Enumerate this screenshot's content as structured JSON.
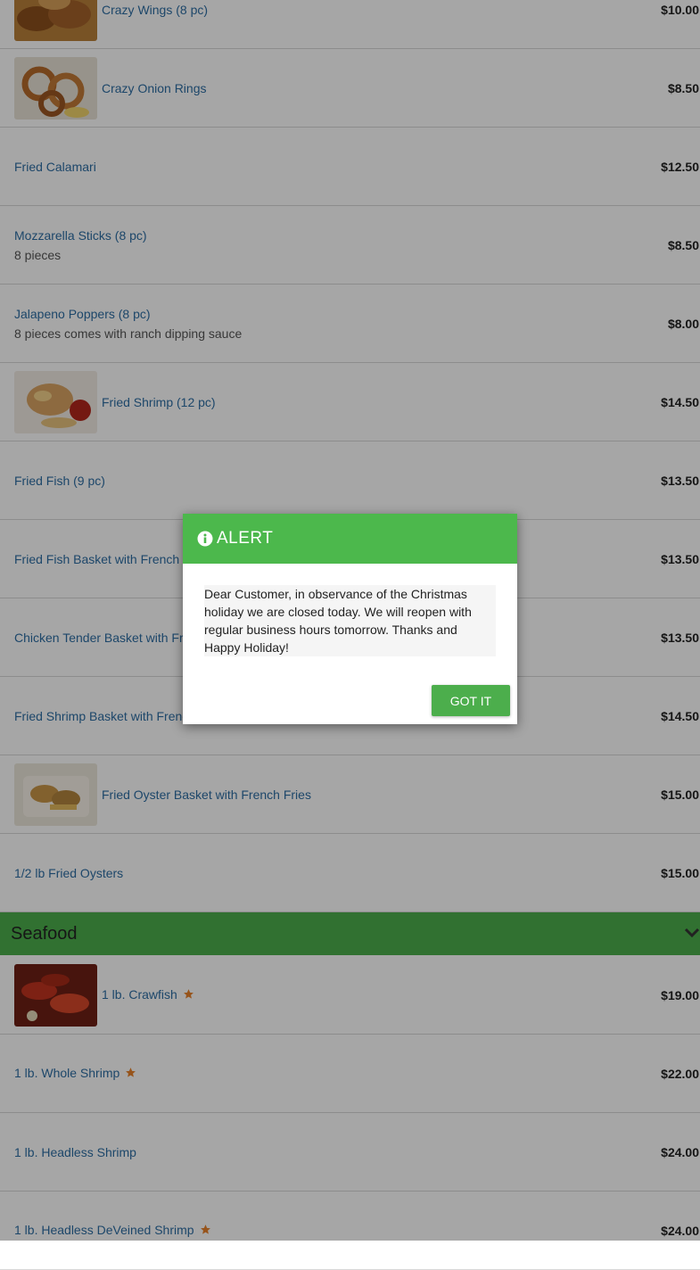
{
  "items_top": [
    {
      "name": "Crazy Wings (8 pc)",
      "desc": "",
      "price": "$10.00",
      "image": "wings-photo"
    },
    {
      "name": "Crazy Onion Rings",
      "desc": "",
      "price": "$8.50",
      "image": "onion-rings-photo"
    },
    {
      "name": "Fried Calamari",
      "desc": "",
      "price": "$12.50"
    },
    {
      "name": "Mozzarella Sticks (8 pc)",
      "desc": "8 pieces",
      "price": "$8.50"
    },
    {
      "name": "Jalapeno Poppers (8 pc)",
      "desc": "8 pieces comes with ranch dipping sauce",
      "price": "$8.00"
    },
    {
      "name": "Fried Shrimp (12 pc)",
      "desc": "",
      "price": "$14.50",
      "image": "fried-shrimp-photo"
    },
    {
      "name": "Fried Fish (9 pc)",
      "desc": "",
      "price": "$13.50"
    },
    {
      "name": "Fried Fish Basket with French Fries",
      "desc": "",
      "price": "$13.50"
    },
    {
      "name": "Chicken Tender Basket with French Fries",
      "desc": "",
      "price": "$13.50"
    },
    {
      "name": "Fried Shrimp Basket with French Fries",
      "desc": "",
      "price": "$14.50"
    },
    {
      "name": "Fried Oyster Basket with French Fries",
      "desc": "",
      "price": "$15.00",
      "image": "oyster-basket-photo"
    },
    {
      "name": "1/2 lb Fried Oysters",
      "desc": "",
      "price": "$15.00"
    }
  ],
  "section": {
    "title": "Seafood",
    "icon": "chevron-down-icon"
  },
  "items_seafood": [
    {
      "name": "1 lb. Crawfish",
      "price": "$19.00",
      "image": "crawfish-photo",
      "popular": true
    },
    {
      "name": "1 lb. Whole Shrimp",
      "price": "$22.00",
      "popular": true
    },
    {
      "name": "1 lb. Headless Shrimp",
      "price": "$24.00",
      "popular": false
    },
    {
      "name": "1 lb. Headless DeVeined Shrimp",
      "price": "$24.00",
      "popular": true
    }
  ],
  "modal": {
    "title": "ALERT",
    "icon": "info-circle-icon",
    "message": "Dear Customer, in observance of the Christmas holiday we are closed today. We will reopen with regular business hours tomorrow. Thanks and Happy Holiday!",
    "button_label": "GOT IT"
  },
  "colors": {
    "link": "#2d6da3",
    "section_bg": "#4cae4c",
    "modal_header": "#4cb84c",
    "star": "#e8822a"
  }
}
